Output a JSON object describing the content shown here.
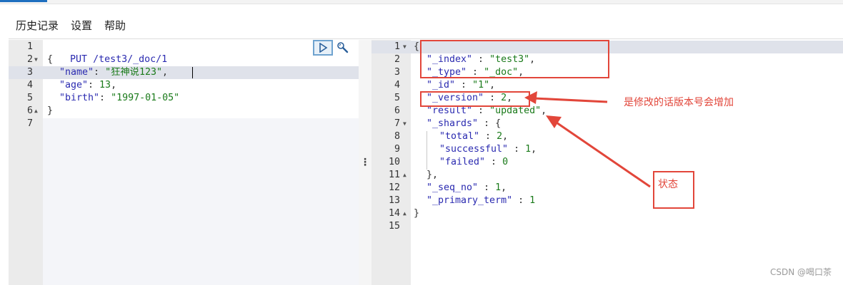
{
  "menu": {
    "history": "历史记录",
    "settings": "设置",
    "help": "帮助"
  },
  "request": {
    "line_numbers": [
      "1",
      "2",
      "3",
      "4",
      "5",
      "6",
      "7"
    ],
    "method": "PUT",
    "url": "/test3/_doc/1",
    "open_brace": "{",
    "name_key": "\"name\"",
    "name_value": "\"狂神说123\"",
    "age_key": "\"age\"",
    "age_value": "13",
    "birth_key": "\"birth\"",
    "birth_value": "\"1997-01-05\"",
    "close_brace": "}",
    "colon_sep": ": ",
    "comma": ","
  },
  "response": {
    "line_numbers": [
      "1",
      "2",
      "3",
      "4",
      "5",
      "6",
      "7",
      "8",
      "9",
      "10",
      "11",
      "12",
      "13",
      "14",
      "15"
    ],
    "open_brace": "{",
    "index_key": "\"_index\"",
    "index_value": "\"test3\"",
    "type_key": "\"_type\"",
    "type_value": "\"_doc\"",
    "id_key": "\"_id\"",
    "id_value": "\"1\"",
    "version_key": "\"_version\"",
    "version_value": "2",
    "result_key": "\"result\"",
    "result_value": "\"updated\"",
    "shards_key": "\"_shards\"",
    "shards_open": "{",
    "total_key": "\"total\"",
    "total_value": "2",
    "successful_key": "\"successful\"",
    "successful_value": "1",
    "failed_key": "\"failed\"",
    "failed_value": "0",
    "shards_close": "},",
    "seq_no_key": "\"_seq_no\"",
    "seq_no_value": "1",
    "primary_term_key": "\"_primary_term\"",
    "primary_term_value": "1",
    "close_brace": "}",
    "colon_sep": " : ",
    "comma": ","
  },
  "annotations": {
    "version_note": "是修改的话版本号会增加",
    "status_note": "状态",
    "arrow_color": "#e2463a"
  },
  "splitter_glyph": "⋮",
  "watermark": "CSDN @喝口茶",
  "icons": {
    "run": "play-icon",
    "settings": "wrench-icon"
  }
}
